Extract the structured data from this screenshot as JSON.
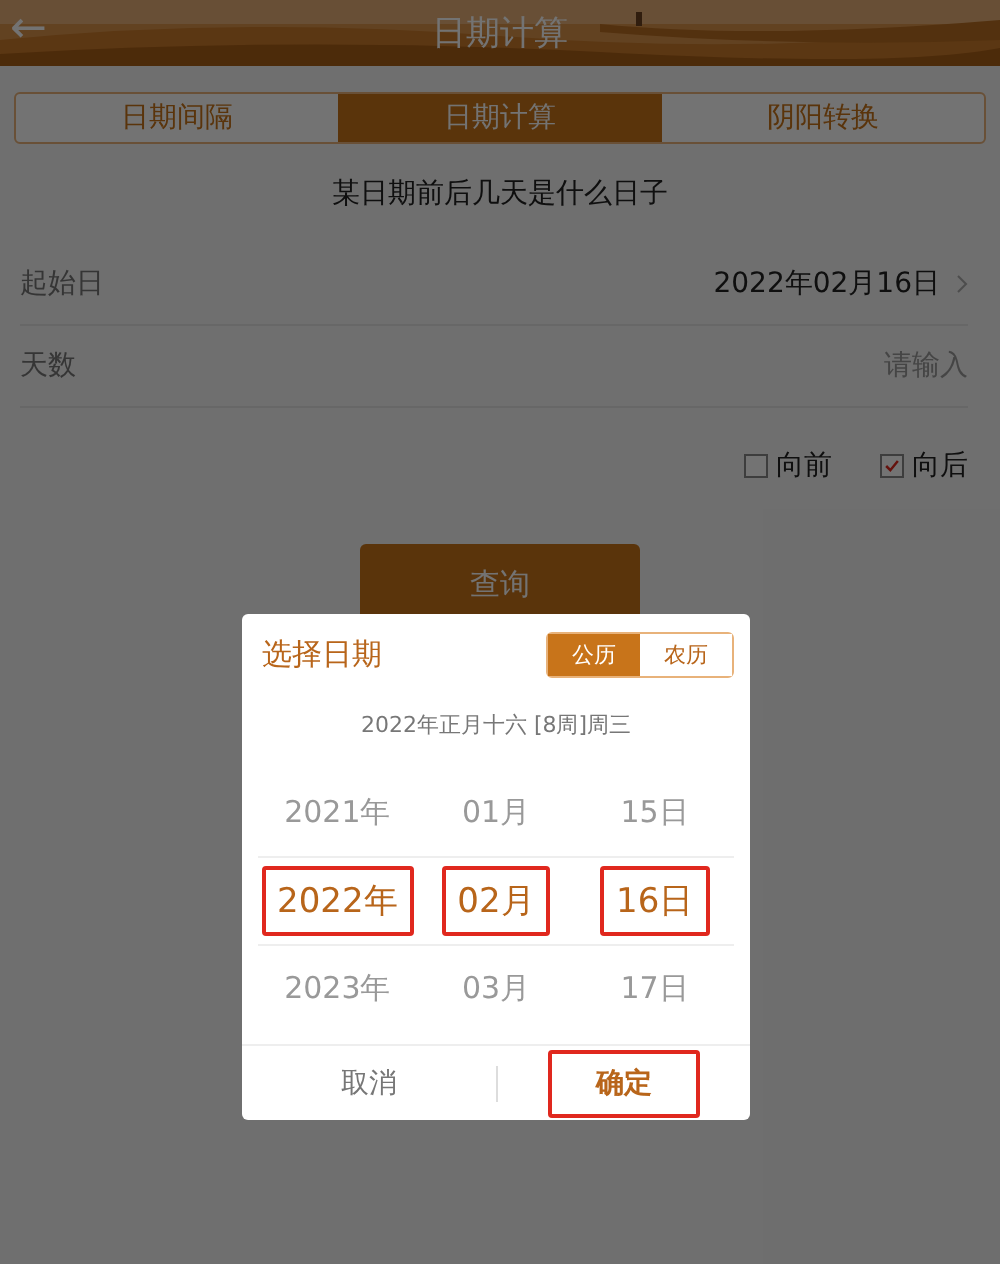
{
  "header": {
    "title": "日期计算",
    "back": "←"
  },
  "tabs": [
    {
      "label": "日期间隔",
      "selected": false
    },
    {
      "label": "日期计算",
      "selected": true
    },
    {
      "label": "阴阳转换",
      "selected": false
    }
  ],
  "subtitle": "某日期前后几天是什么日子",
  "form": [
    {
      "label": "起始日",
      "value": "2022年02月16日",
      "kind": "select"
    },
    {
      "label": "天数",
      "placeholder": "请输入",
      "kind": "input"
    }
  ],
  "directions": [
    {
      "label": "向前",
      "checked": false
    },
    {
      "label": "向后",
      "checked": true
    }
  ],
  "query_button": "查询",
  "dialog": {
    "title": "选择日期",
    "calendars": [
      {
        "label": "公历",
        "selected": true
      },
      {
        "label": "农历",
        "selected": false
      }
    ],
    "lunar_info": "2022年正月十六 [8周]周三",
    "columns": [
      {
        "items": [
          {
            "text": "2021年",
            "selected": false
          },
          {
            "text": "2022年",
            "selected": true
          },
          {
            "text": "2023年",
            "selected": false
          }
        ]
      },
      {
        "items": [
          {
            "text": "01月",
            "selected": false
          },
          {
            "text": "02月",
            "selected": true
          },
          {
            "text": "03月",
            "selected": false
          }
        ]
      },
      {
        "items": [
          {
            "text": "15日",
            "selected": false
          },
          {
            "text": "16日",
            "selected": true
          },
          {
            "text": "17日",
            "selected": false
          }
        ]
      }
    ],
    "buttons": [
      {
        "label": "取消",
        "kind": "cancel",
        "highlighted": false
      },
      {
        "label": "确定",
        "kind": "confirm",
        "highlighted": true
      }
    ]
  }
}
